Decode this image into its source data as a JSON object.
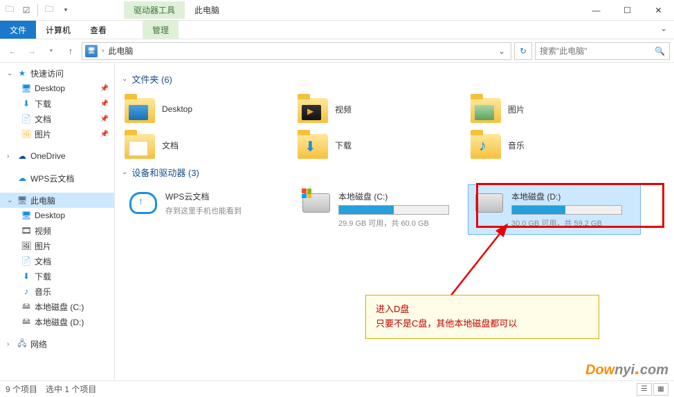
{
  "titlebar": {
    "drive_tools": "驱动器工具",
    "this_pc": "此电脑"
  },
  "ribbon": {
    "file": "文件",
    "computer": "计算机",
    "view": "查看",
    "manage": "管理"
  },
  "nav": {
    "breadcrumb": "此电脑",
    "search_placeholder": "搜索\"此电脑\""
  },
  "sidebar": {
    "quick": "快速访问",
    "desktop": "Desktop",
    "downloads": "下载",
    "documents": "文档",
    "pictures": "图片",
    "onedrive": "OneDrive",
    "wps": "WPS云文档",
    "thispc": "此电脑",
    "pc_desktop": "Desktop",
    "pc_video": "视频",
    "pc_pictures": "图片",
    "pc_documents": "文档",
    "pc_downloads": "下载",
    "pc_music": "音乐",
    "disk_c": "本地磁盘 (C:)",
    "disk_d": "本地磁盘 (D:)",
    "network": "网络"
  },
  "groups": {
    "folders": "文件夹 (6)",
    "devices": "设备和驱动器 (3)"
  },
  "folders": {
    "desktop": "Desktop",
    "video": "视频",
    "pictures": "图片",
    "documents": "文档",
    "downloads": "下载",
    "music": "音乐"
  },
  "drives": {
    "wps_name": "WPS云文档",
    "wps_sub": "存到这里手机也能看到",
    "c_name": "本地磁盘 (C:)",
    "c_sub": "29.9 GB 可用，共 60.0 GB",
    "c_fill_pct": 50,
    "d_name": "本地磁盘 (D:)",
    "d_sub": "30.0 GB 可用，共 59.2 GB",
    "d_fill_pct": 49
  },
  "annotation": {
    "line1": "进入D盘",
    "line2": "只要不是C盘，其他本地磁盘都可以"
  },
  "status": {
    "items": "9 个项目",
    "selected": "选中 1 个项目"
  },
  "watermark": {
    "a": "Dow",
    "b": "nyi",
    "c": "com"
  }
}
